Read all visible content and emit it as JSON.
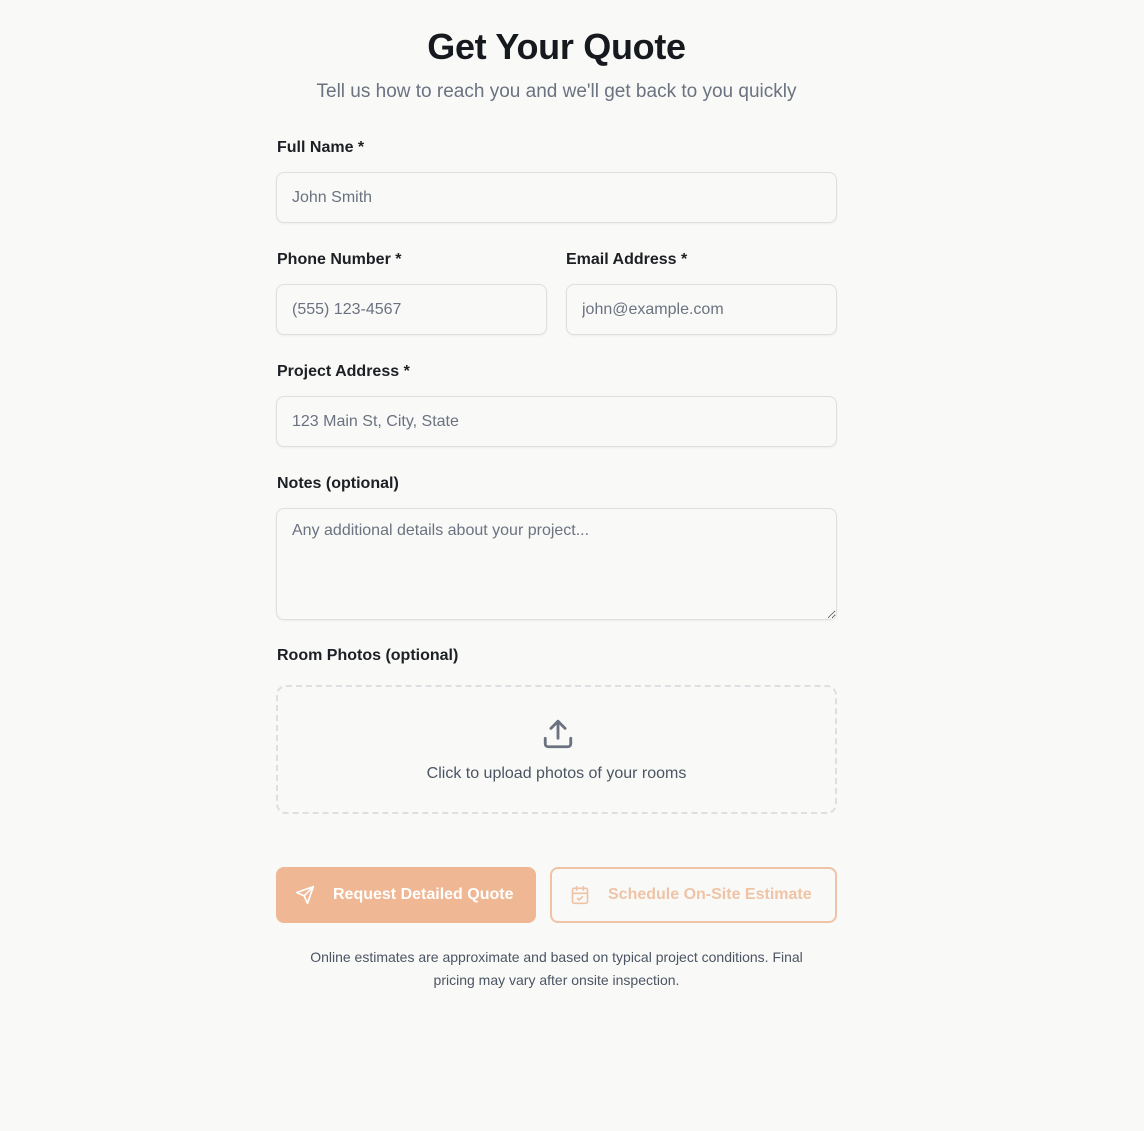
{
  "header": {
    "title": "Get Your Quote",
    "subtitle": "Tell us how to reach you and we'll get back to you quickly"
  },
  "fields": {
    "full_name": {
      "label": "Full Name *",
      "placeholder": "John Smith",
      "value": ""
    },
    "phone": {
      "label": "Phone Number *",
      "placeholder": "(555) 123-4567",
      "value": ""
    },
    "email": {
      "label": "Email Address *",
      "placeholder": "john@example.com",
      "value": ""
    },
    "address": {
      "label": "Project Address *",
      "placeholder": "123 Main St, City, State",
      "value": ""
    },
    "notes": {
      "label": "Notes (optional)",
      "placeholder": "Any additional details about your project...",
      "value": ""
    }
  },
  "upload": {
    "label": "Room Photos (optional)",
    "text": "Click to upload photos of your rooms",
    "icon": "upload-icon"
  },
  "actions": {
    "primary_label": "Request Detailed Quote",
    "primary_icon": "send-icon",
    "secondary_label": "Schedule On-Site Estimate",
    "secondary_icon": "calendar-icon"
  },
  "disclaimer": "Online estimates are approximate and based on typical project conditions. Final pricing may vary after onsite inspection.",
  "colors": {
    "accent": "#efb793",
    "accent_light": "#efc4a6",
    "background": "#f9f9f7"
  }
}
